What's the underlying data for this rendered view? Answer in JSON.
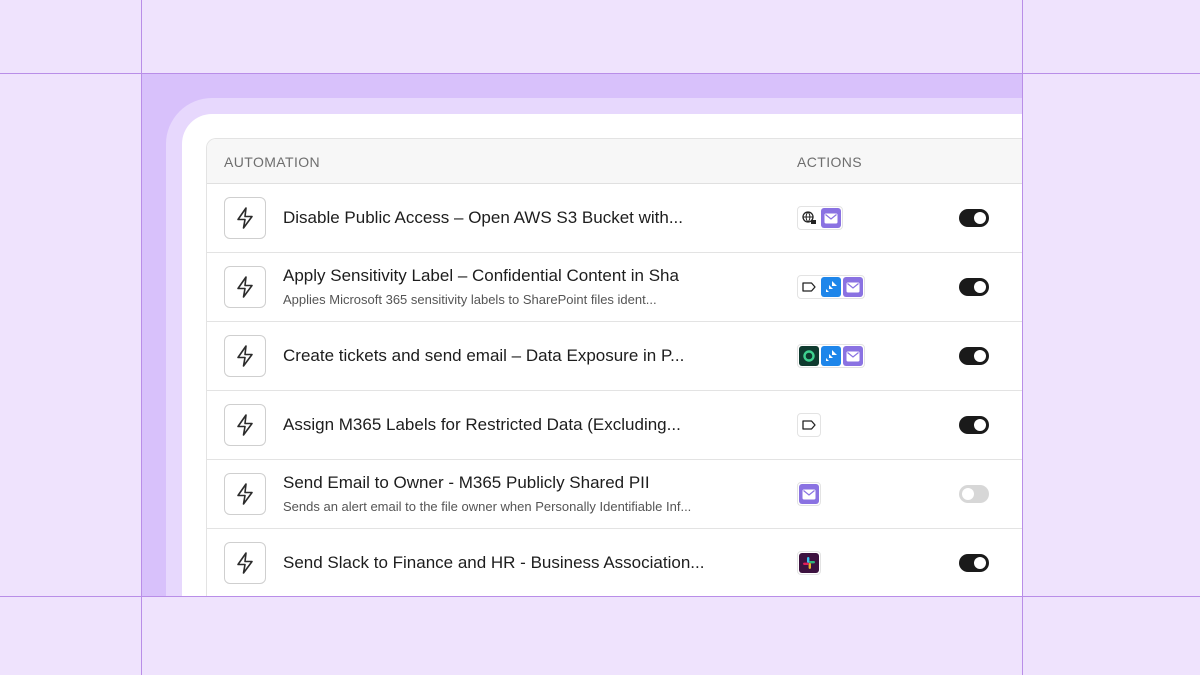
{
  "table": {
    "col_automation": "AUTOMATION",
    "col_actions": "ACTIONS"
  },
  "rows": [
    {
      "title": "Disable Public Access – Open AWS S3 Bucket with...",
      "description": "",
      "actions": [
        "globe-lock-icon",
        "mail-icon"
      ],
      "enabled": true
    },
    {
      "title": "Apply Sensitivity Label – Confidential Content in Sha",
      "description": "Applies Microsoft 365 sensitivity labels to SharePoint files ident...",
      "actions": [
        "label-tag-icon",
        "jira-icon",
        "mail-icon"
      ],
      "enabled": true
    },
    {
      "title": "Create tickets and send email – Data Exposure in P...",
      "description": "",
      "actions": [
        "ring-app-icon",
        "jira-icon",
        "mail-icon"
      ],
      "enabled": true
    },
    {
      "title": "Assign M365 Labels for Restricted Data (Excluding...",
      "description": "",
      "actions": [
        "label-tag-icon"
      ],
      "enabled": true
    },
    {
      "title": "Send Email to Owner - M365 Publicly Shared PII",
      "description": "Sends an alert email to the file owner when Personally Identifiable Inf...",
      "actions": [
        "mail-icon"
      ],
      "enabled": false
    },
    {
      "title": "Send Slack to Finance and HR - Business Association...",
      "description": "",
      "actions": [
        "slack-icon"
      ],
      "enabled": true
    }
  ],
  "colors": {
    "background": "#efe3fd",
    "accent_purple": "#8a72e2",
    "toggle_on": "#1a1a1a",
    "toggle_off": "#d7d7d7"
  }
}
